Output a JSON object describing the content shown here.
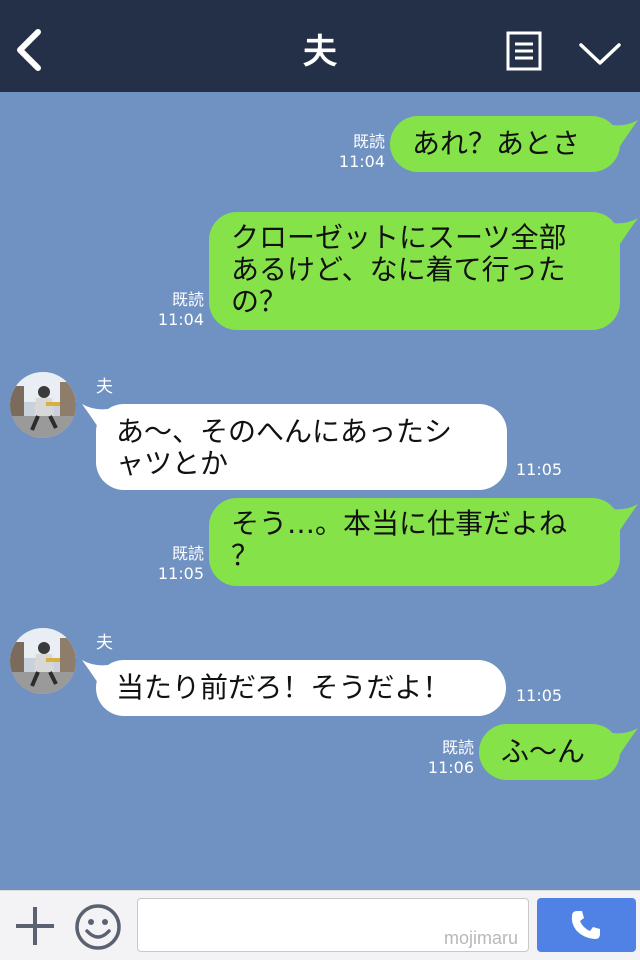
{
  "header": {
    "title": "夫",
    "back_icon": "chevron-left-icon",
    "menu_icon": "notes-icon",
    "expand_icon": "chevron-down-icon"
  },
  "messages": [
    {
      "from": "me",
      "text": "あれ？あとさ",
      "read": "既読",
      "time": "11:04"
    },
    {
      "from": "me",
      "text": "クローゼットにスーツ全部\nあるけど、なに着て行った\nの？",
      "read": "既読",
      "time": "11:04"
    },
    {
      "from": "them",
      "sender": "夫",
      "text": "あ～、そのへんにあったシ\nャツとか",
      "time": "11:05"
    },
    {
      "from": "me",
      "text": "そう…。本当に仕事だよね\n？",
      "read": "既読",
      "time": "11:05"
    },
    {
      "from": "them",
      "sender": "夫",
      "text": "当たり前だろ！そうだよ！",
      "time": "11:05"
    },
    {
      "from": "me",
      "text": "ふ～ん",
      "read": "既読",
      "time": "11:06"
    }
  ],
  "footer": {
    "input_value": "",
    "watermark": "mojimaru",
    "plus_icon": "plus-icon",
    "emoji_icon": "smiley-icon",
    "call_icon": "phone-icon"
  },
  "colors": {
    "header_bg": "#243048",
    "chat_bg": "#7092c2",
    "my_bubble": "#85e249",
    "their_bubble": "#ffffff",
    "call_button": "#5082e6"
  }
}
